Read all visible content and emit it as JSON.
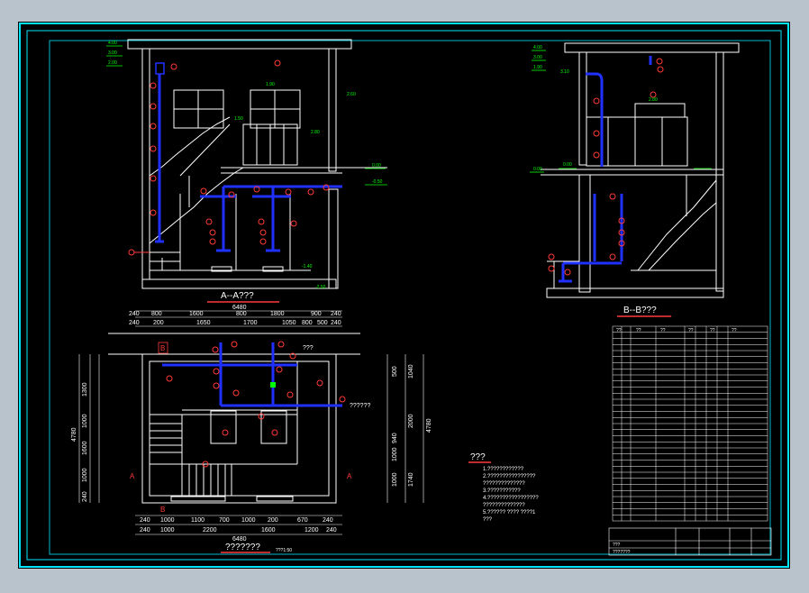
{
  "colors": {
    "background": "#000000",
    "outer_frame": "#00e5ff",
    "walls": "#ffffff",
    "pipe": "#2030ff",
    "callout": "#ff3a3a",
    "dimension": "#ffffff",
    "elevation": "#00ff00"
  },
  "section_a": {
    "title": "A--A???",
    "elevations": [
      "4.00",
      "3.00",
      "2.00",
      "1.90",
      "2.60",
      "1.50",
      "2.80",
      "0.00",
      "-0.50",
      "-1.40",
      "-2.50"
    ]
  },
  "section_b": {
    "title": "B--B???",
    "elevations": [
      "4.00",
      "3.00",
      "1.90",
      "3.10",
      "2.80",
      "0.00",
      "0.00"
    ]
  },
  "plan": {
    "title": "???????",
    "scale": "???1:50",
    "total_width": "6480",
    "top_dims": [
      "240",
      "800",
      "1600",
      "800",
      "1800",
      "900",
      "240"
    ],
    "top_dims_2": [
      "240",
      "200",
      "1650",
      "1700",
      "1050",
      "800",
      "500",
      "240"
    ],
    "bottom_dims": [
      "240",
      "1000",
      "1100",
      "700",
      "1000",
      "200",
      "670",
      "240"
    ],
    "bottom_dims_2": [
      "240",
      "1000",
      "2200",
      "1600",
      "1200",
      "240"
    ],
    "bottom_total": "6480",
    "left_dims": [
      "1300",
      "1000",
      "1600",
      "1000",
      "240"
    ],
    "left_total": "4780",
    "right_dims": [
      "1040",
      "2000",
      "1740"
    ],
    "right_dims_inner": [
      "500",
      "940",
      "1000",
      "1000"
    ],
    "right_total": "4780",
    "pipe_label": "??????",
    "section_marks": {
      "a": "A",
      "b": "B"
    },
    "room_label": "???"
  },
  "notes": {
    "title": "???",
    "lines": [
      "1.????????????",
      "2.????????????????",
      "   ??????????????",
      "3.???????????",
      "4.?????????????????",
      "   ??????????????",
      "5.?????? ???? ????1",
      "   ???"
    ]
  },
  "equipment_table": {
    "headers": [
      "??",
      "??",
      "??",
      "??",
      "??",
      "??"
    ],
    "row_count": 31
  },
  "title_block": {
    "rows": [
      "???",
      "???????"
    ]
  }
}
